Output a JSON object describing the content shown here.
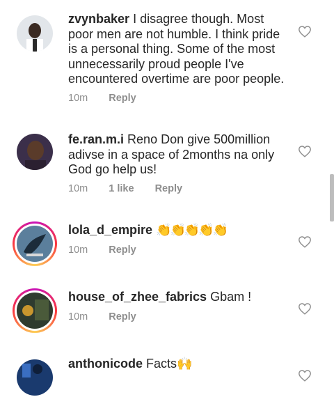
{
  "comments": [
    {
      "username": "zvynbaker",
      "text": "I disagree though. Most poor men are not humble. I think pride is a personal thing. Some of the most unnecessarily proud people I've encountered overtime are poor people.",
      "time": "10m",
      "likes": "",
      "reply": "Reply",
      "has_story": false,
      "avatar_colors": [
        "#dfe3e8",
        "#2a2a2a",
        "#ffffff"
      ]
    },
    {
      "username": "fe.ran.m.i",
      "text": "Reno Don give 500million adivse in a space of 2months na only God go help us!",
      "time": "10m",
      "likes": "1 like",
      "reply": "Reply",
      "has_story": false,
      "avatar_colors": [
        "#3b2a4d",
        "#5a3b2a"
      ]
    },
    {
      "username": "lola_d_empire",
      "text": "👏👏👏👏👏",
      "time": "10m",
      "likes": "",
      "reply": "Reply",
      "has_story": true,
      "avatar_colors": [
        "#5a7d9a",
        "#1a2b3c"
      ]
    },
    {
      "username": "house_of_zhee_fabrics",
      "text": "Gbam !",
      "time": "10m",
      "likes": "",
      "reply": "Reply",
      "has_story": true,
      "avatar_colors": [
        "#2f3b2f",
        "#c9962e"
      ]
    },
    {
      "username": "anthonicode",
      "text": "Facts🙌",
      "time": "",
      "likes": "",
      "reply": "",
      "has_story": false,
      "avatar_colors": [
        "#1a3a6e",
        "#3a6ec2"
      ]
    }
  ],
  "colors": {
    "text": "#262626",
    "muted": "#8e8e8e",
    "heart_outline": "#8e8e8e"
  }
}
